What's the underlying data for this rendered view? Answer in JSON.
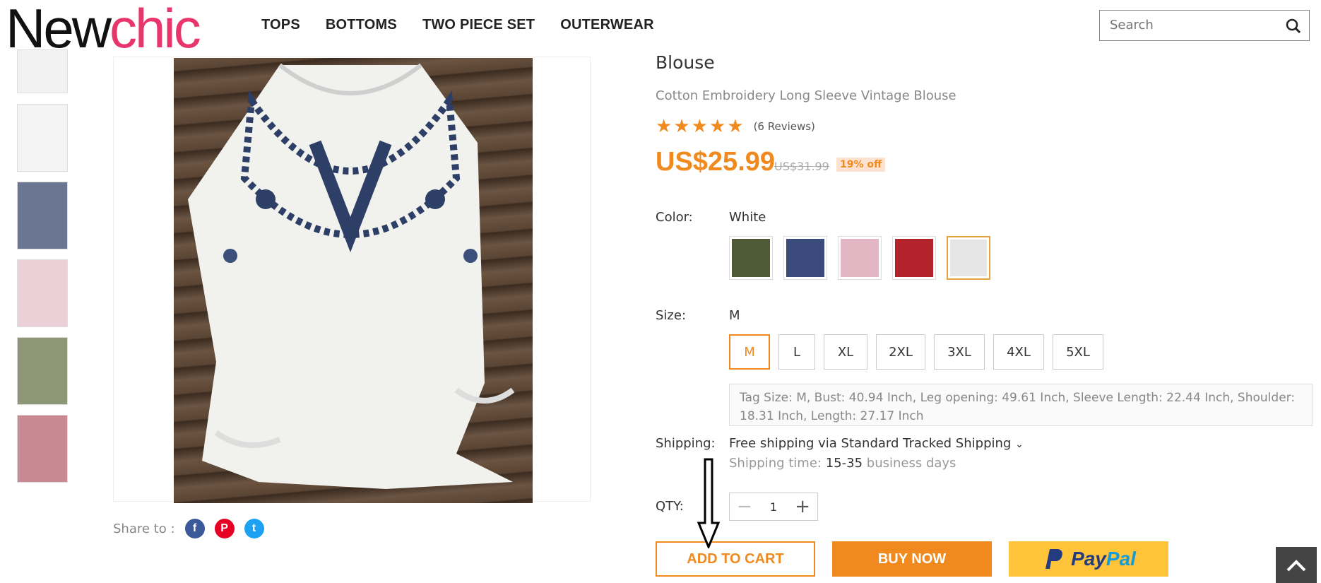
{
  "header": {
    "logo_part1": "New",
    "logo_part2": "chic",
    "nav": [
      "TOPS",
      "BOTTOMS",
      "TWO PIECE SET",
      "OUTERWEAR"
    ],
    "search_placeholder": "Search"
  },
  "product": {
    "title": "Blouse",
    "subtitle": "Cotton Embroidery Long Sleeve Vintage Blouse",
    "rating": 5,
    "reviews": "(6 Reviews)",
    "price": "US$25.99",
    "old_price": "US$31.99",
    "discount": "19% off"
  },
  "options": {
    "color_label": "Color:",
    "color_value": "White",
    "swatch_colors": [
      "#4e5b36",
      "#3a4a7a",
      "#e2b6c2",
      "#b3232c",
      "#e6e6e6"
    ],
    "size_label": "Size:",
    "size_value": "M",
    "sizes": [
      "M",
      "L",
      "XL",
      "2XL",
      "3XL",
      "4XL",
      "5XL"
    ],
    "size_info": "Tag Size: M, Bust: 40.94 Inch, Leg opening: 49.61 Inch, Sleeve Length: 22.44 Inch, Shoulder: 18.31 Inch, Length: 27.17 Inch",
    "shipping_label": "Shipping:",
    "shipping_value": "Free shipping via Standard Tracked Shipping",
    "shipping_time_label": "Shipping time:",
    "shipping_time_value": "15-35",
    "shipping_time_unit": "business days",
    "qty_label": "QTY:",
    "qty_value": "1"
  },
  "actions": {
    "add_to_cart": "ADD TO CART",
    "buy_now": "BUY NOW",
    "paypal_1": "Pay",
    "paypal_2": "Pal"
  },
  "share": {
    "label": "Share to :"
  },
  "thumb_colors": [
    "#f2f2f2",
    "#f4f4f4",
    "#6b7792",
    "#ecd0d8",
    "#8d9677",
    "#c98992"
  ],
  "colors": {
    "accent": "#f08a1e",
    "brand_pink": "#e8356b"
  }
}
